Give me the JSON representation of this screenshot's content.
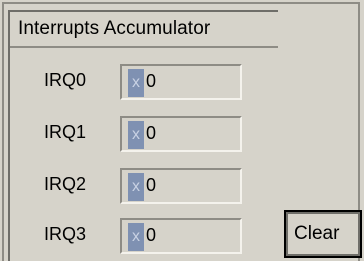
{
  "panel": {
    "title": "Interrupts Accumulator"
  },
  "irqs": [
    {
      "label": "IRQ0",
      "indicator": "x",
      "value": "0"
    },
    {
      "label": "IRQ1",
      "indicator": "x",
      "value": "0"
    },
    {
      "label": "IRQ2",
      "indicator": "x",
      "value": "0"
    },
    {
      "label": "IRQ3",
      "indicator": "x",
      "value": "0"
    }
  ],
  "actions": {
    "clear_label": "Clear"
  },
  "colors": {
    "background": "#d6d3ca",
    "indicator": "#7f91b2"
  }
}
